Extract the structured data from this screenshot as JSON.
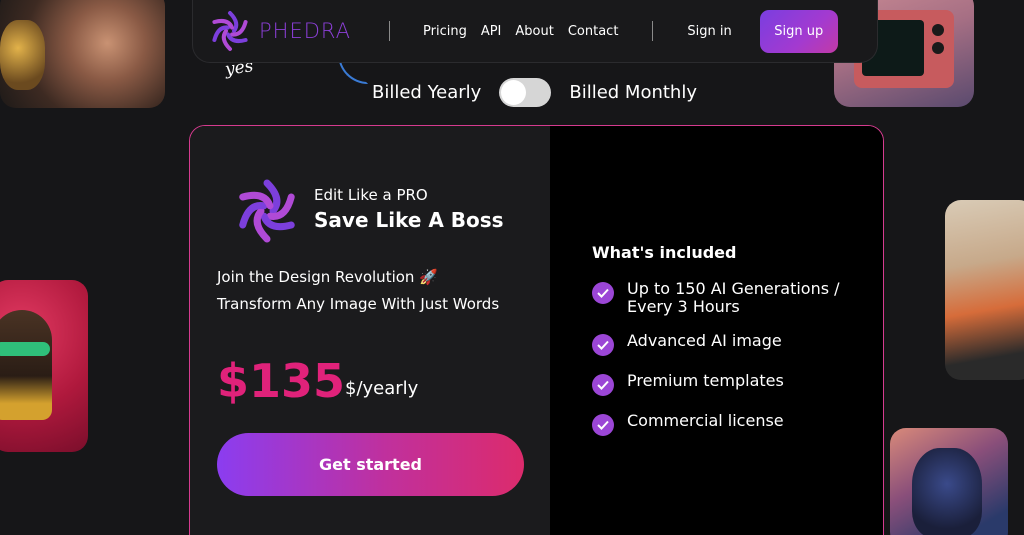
{
  "brand": {
    "name": "PHEDRA",
    "logo_icon": "phedra-star-logo-icon",
    "accent": "#8c3fd8"
  },
  "nav": {
    "links": [
      "Pricing",
      "API",
      "About",
      "Contact"
    ],
    "signin_label": "Sign in",
    "signup_label": "Sign up"
  },
  "hero_script": "yes",
  "billing": {
    "yearly_label": "Billed Yearly",
    "monthly_label": "Billed Monthly",
    "toggle_state": "yearly"
  },
  "plan": {
    "tagline_line1": "Edit Like a PRO",
    "tagline_line2": "Save Like A Boss",
    "description": "Join the Design Revolution 🚀 Transform Any Image With Just Words",
    "price": "$135",
    "period": "$/yearly",
    "cta_label": "Get started",
    "price_color": "#e0227a"
  },
  "included": {
    "title": "What's included",
    "features": [
      "Up to 150 AI Generations / Every 3 Hours",
      "Advanced AI image",
      "Premium templates",
      "Commercial license"
    ],
    "check_icon": "check-circle-icon"
  }
}
